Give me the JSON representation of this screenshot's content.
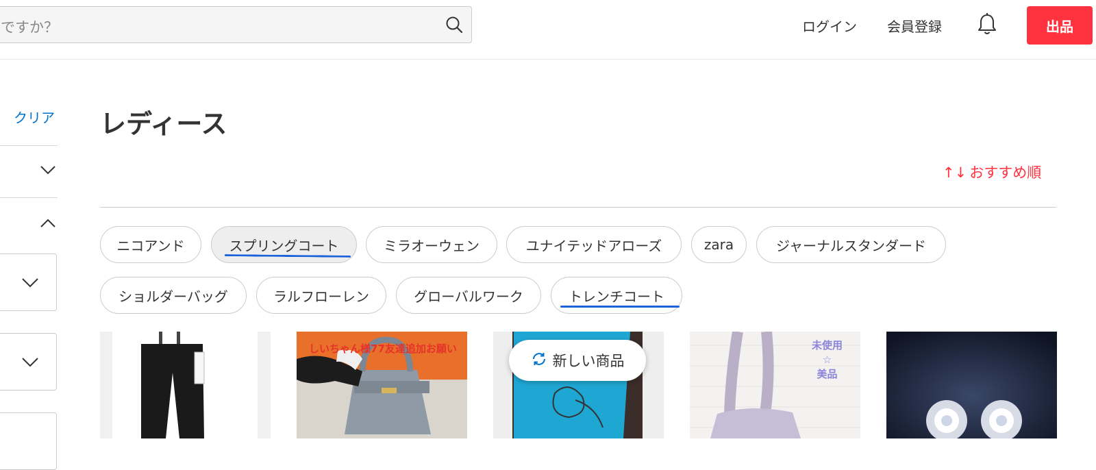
{
  "header": {
    "search_placeholder": "ですか？",
    "login": "ログイン",
    "signup": "会員登録",
    "sell": "出品"
  },
  "sidebar": {
    "clear": "クリア"
  },
  "main": {
    "title": "レディース",
    "sort_label": "おすすめ順",
    "sort_icon": "↑↓"
  },
  "chips": [
    {
      "label": "ニコアンド",
      "active": false
    },
    {
      "label": "スプリングコート",
      "active": true
    },
    {
      "label": "ミラオーウェン",
      "active": false
    },
    {
      "label": "ユナイテッドアローズ",
      "active": false
    },
    {
      "label": "zara",
      "active": false
    },
    {
      "label": "ジャーナルスタンダード",
      "active": false
    },
    {
      "label": "ショルダーバッグ",
      "active": false
    },
    {
      "label": "ラルフローレン",
      "active": false
    },
    {
      "label": "グローバルワーク",
      "active": false
    },
    {
      "label": "トレンチコート",
      "active": false
    }
  ],
  "products": {
    "card2_overlay": "しいちゃん様77友達追加お願い",
    "card4_overlay": [
      "未使用",
      "☆",
      "美品"
    ]
  },
  "toast": "新しい商品",
  "colors": {
    "accent_red": "#ff333f",
    "link_blue": "#0073cc",
    "underline_blue": "#1a63d8"
  }
}
